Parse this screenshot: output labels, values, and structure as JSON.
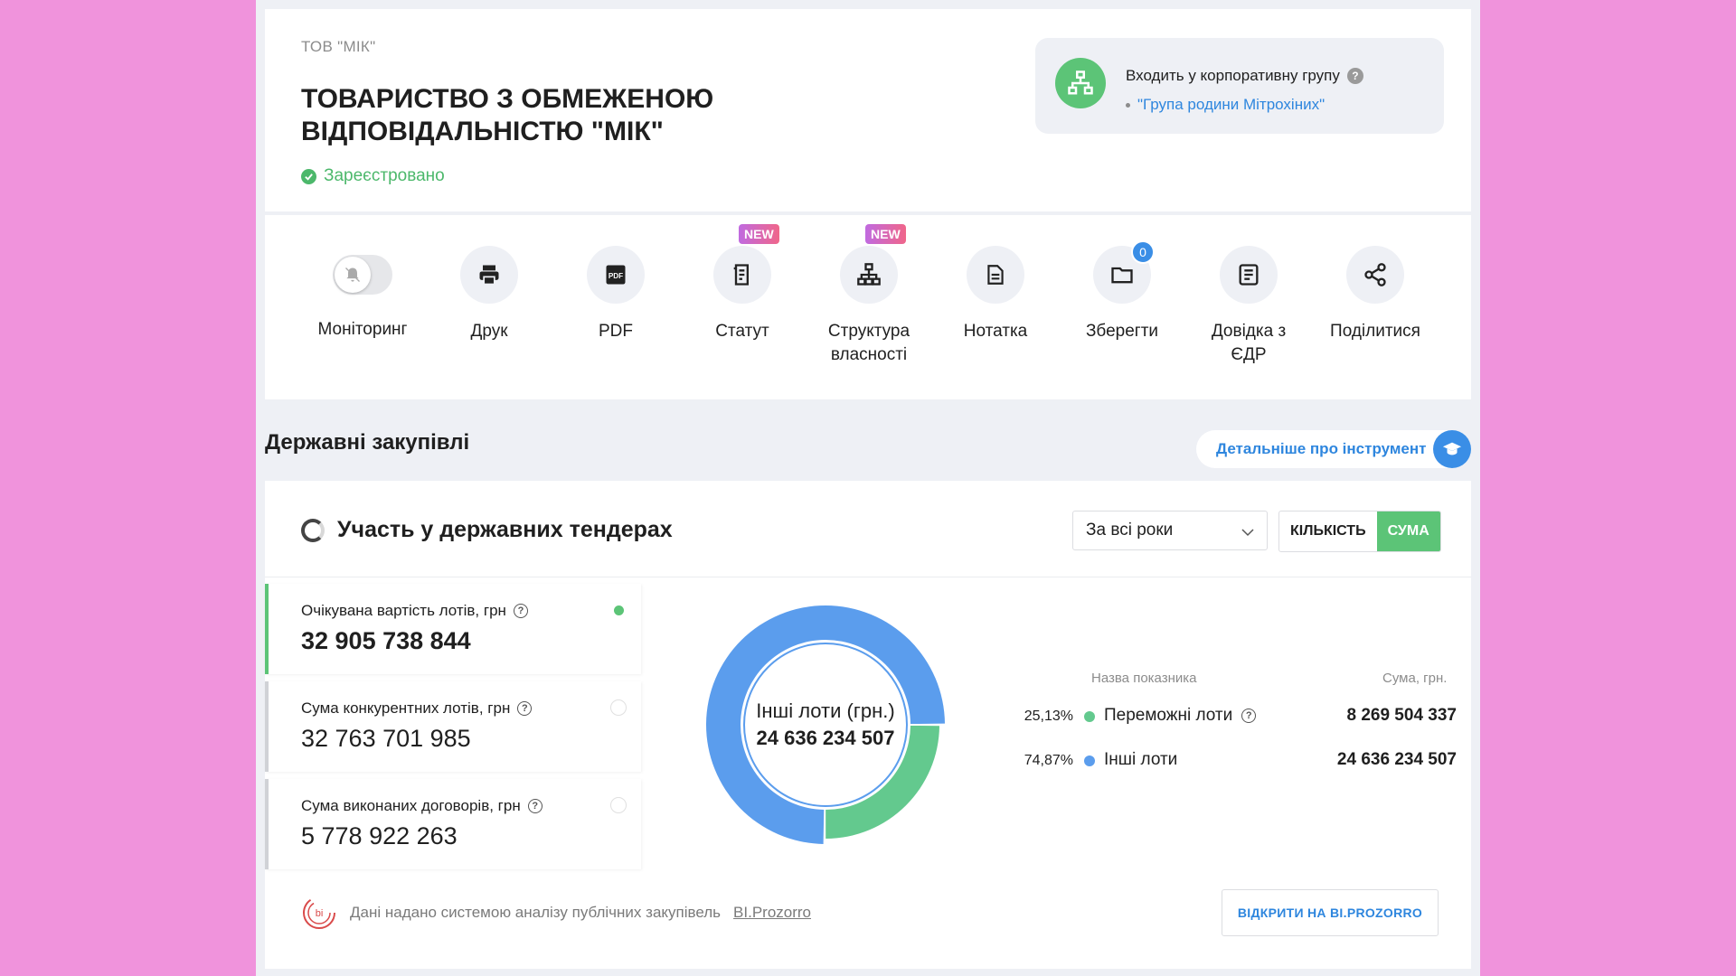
{
  "company": {
    "short_name": "ТОВ \"МІК\"",
    "full_name": "ТОВАРИСТВО З ОБМЕЖЕНОЮ ВІДПОВІДАЛЬНІСТЮ \"МІК\"",
    "status": "Зареєстровано"
  },
  "group": {
    "title": "Входить у корпоративну групу",
    "link": "\"Група родини Мітрохіних\"",
    "icon": "org-structure-icon"
  },
  "actions": [
    {
      "label": "Моніторинг",
      "icon": "bell-icon"
    },
    {
      "label": "Друк",
      "icon": "printer-icon"
    },
    {
      "label": "PDF",
      "icon": "pdf-icon"
    },
    {
      "label": "Статут",
      "icon": "document-icon",
      "badge": "NEW"
    },
    {
      "label": "Структура власності",
      "icon": "org-structure-icon",
      "badge": "NEW"
    },
    {
      "label": "Нотатка",
      "icon": "note-icon"
    },
    {
      "label": "Зберегти",
      "icon": "folder-icon",
      "count": "0"
    },
    {
      "label": "Довідка з ЄДР",
      "icon": "register-icon"
    },
    {
      "label": "Поділитися",
      "icon": "share-icon"
    }
  ],
  "section": {
    "title": "Державні закупівлі",
    "more_label": "Детальніше про інструмент"
  },
  "tenders": {
    "title": "Участь у державних тендерах",
    "period": "За всі роки",
    "toggle": {
      "count": "КІЛЬКІСТЬ",
      "sum": "СУМА",
      "active": "sum"
    },
    "metrics": [
      {
        "label": "Очікувана вартість лотів, грн",
        "value": "32 905 738 844"
      },
      {
        "label": "Сума конкурентних лотів, грн",
        "value": "32 763 701 985"
      },
      {
        "label": "Сума виконаних договорів, грн",
        "value": "5 778 922 263"
      }
    ],
    "donut_center_label": "Інші лоти (грн.)",
    "donut_center_value": "24 636 234 507",
    "legend_header_name": "Назва показника",
    "legend_header_sum": "Сума, грн.",
    "source_text": "Дані надано системою аналізу публічних закупівель",
    "source_link": "BI.Prozorro",
    "open_button": "ВІДКРИТИ НА BI.PROZORRO"
  },
  "chart_data": {
    "type": "pie",
    "categories": [
      "Переможні лоти",
      "Інші лоти"
    ],
    "values": [
      8269504337,
      24636234507
    ],
    "value_labels": [
      "8 269 504 337",
      "24 636 234 507"
    ],
    "percents": [
      "25,13%",
      "74,87%"
    ],
    "colors": [
      "#63c98e",
      "#5b9ded"
    ]
  },
  "colors": {
    "accent_green": "#5cc477",
    "accent_blue": "#2e86de",
    "background": "#f093dc"
  }
}
